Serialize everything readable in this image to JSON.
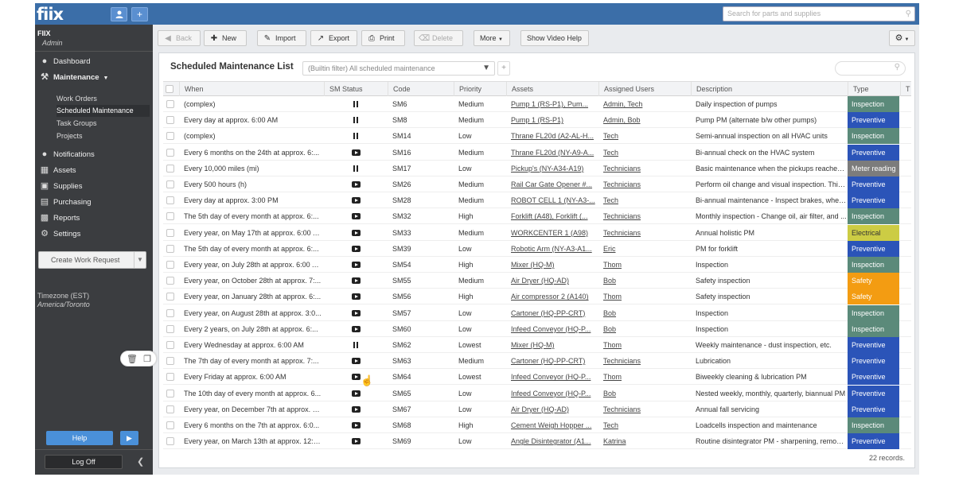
{
  "app": {
    "logo": "fiix",
    "org_name": "FIIX",
    "org_role": "Admin"
  },
  "topbar": {
    "user_icon": "user-icon",
    "add_icon": "plus-icon",
    "search_placeholder": "Search for parts and supplies"
  },
  "sidebar": {
    "nav": [
      {
        "label": "Dashboard",
        "icon": "dashboard-icon"
      },
      {
        "label": "Maintenance",
        "icon": "wrench-icon"
      },
      {
        "label": "Notifications",
        "icon": "chat-icon"
      },
      {
        "label": "Assets",
        "icon": "building-icon"
      },
      {
        "label": "Supplies",
        "icon": "box-icon"
      },
      {
        "label": "Purchasing",
        "icon": "cart-icon"
      },
      {
        "label": "Reports",
        "icon": "chart-icon"
      },
      {
        "label": "Settings",
        "icon": "gear-icon"
      }
    ],
    "sub_items": [
      "Work Orders",
      "Scheduled Maintenance",
      "Task Groups",
      "Projects"
    ],
    "create_work_request": "Create Work Request",
    "timezone_label": "Timezone (EST)",
    "timezone_value": "America/Toronto",
    "help": "Help",
    "logoff": "Log Off"
  },
  "toolbar": {
    "back": "Back",
    "new": "New",
    "import": "Import",
    "export": "Export",
    "print": "Print",
    "delete": "Delete",
    "more": "More",
    "show_video_help": "Show Video Help"
  },
  "panel": {
    "title": "Scheduled Maintenance List",
    "filter": "(Builtin filter) All scheduled maintenance",
    "add_filter": "+",
    "columns": [
      "When",
      "SM Status",
      "Code",
      "Priority",
      "Assets",
      "Assigned Users",
      "Description",
      "Type",
      "T"
    ],
    "rows": [
      {
        "when": "(complex)",
        "status": "paused",
        "code": "SM6",
        "priority": "Medium",
        "assets": "Pump 1 (RS-P1), Pum...",
        "users": "Admin, Tech",
        "description": "Daily inspection of pumps",
        "type": "Inspection"
      },
      {
        "when": "Every day at approx. 6:00 AM",
        "status": "paused",
        "code": "SM8",
        "priority": "Medium",
        "assets": "Pump 1 (RS-P1)",
        "users": "Admin, Bob",
        "description": "Pump PM (alternate b/w other pumps)",
        "type": "Preventive"
      },
      {
        "when": "(complex)",
        "status": "paused",
        "code": "SM14",
        "priority": "Low",
        "assets": "Thrane FL20d (A2-AL-H...",
        "users": "Tech",
        "description": "Semi-annual inspection on all HVAC units",
        "type": "Inspection"
      },
      {
        "when": "Every 6 months on the 24th at approx. 6:...",
        "status": "active",
        "code": "SM16",
        "priority": "Medium",
        "assets": "Thrane FL20d (NY-A9-A...",
        "users": "Tech",
        "description": "Bi-annual check on the HVAC system",
        "type": "Preventive"
      },
      {
        "when": "Every 10,000 miles (mi)",
        "status": "paused",
        "code": "SM17",
        "priority": "Low",
        "assets": "Pickup's (NY-A34-A19)",
        "users": "Technicians",
        "description": "Basic maintenance when the pickups reaches ...",
        "type": "Meter reading"
      },
      {
        "when": "Every 500 hours (h)",
        "status": "active",
        "code": "SM26",
        "priority": "Medium",
        "assets": "Rail Car Gate Opener #...",
        "users": "Technicians",
        "description": "Perform oil change and visual inspection. This ...",
        "type": "Preventive"
      },
      {
        "when": "Every day at approx. 3:00 PM",
        "status": "active",
        "code": "SM28",
        "priority": "Medium",
        "assets": "ROBOT CELL 1 (NY-A3-...",
        "users": "Tech",
        "description": "Bi-annual maintenance - Inspect brakes, whee...",
        "type": "Preventive"
      },
      {
        "when": "The 5th day of every month at approx. 6:...",
        "status": "active",
        "code": "SM32",
        "priority": "High",
        "assets": "Forklift (A48), Forklift (...",
        "users": "Technicians",
        "description": "Monthly inspection - Change oil, air filter, and ...",
        "type": "Inspection"
      },
      {
        "when": "Every year, on May 17th at approx. 6:00 AM",
        "status": "active",
        "code": "SM33",
        "priority": "Medium",
        "assets": "WORKCENTER 1 (A98)",
        "users": "Technicians",
        "description": "Annual holistic PM",
        "type": "Electrical"
      },
      {
        "when": "The 5th day of every month at approx. 6:...",
        "status": "active",
        "code": "SM39",
        "priority": "Low",
        "assets": "Robotic Arm (NY-A3-A1...",
        "users": "Eric",
        "description": "PM for forklift",
        "type": "Preventive"
      },
      {
        "when": "Every year, on July 28th at approx. 6:00 AM",
        "status": "active",
        "code": "SM54",
        "priority": "High",
        "assets": "Mixer (HQ-M)",
        "users": "Thom",
        "description": "Inspection",
        "type": "Inspection"
      },
      {
        "when": "Every year, on October 28th at approx. 7:...",
        "status": "active",
        "code": "SM55",
        "priority": "Medium",
        "assets": "Air Dryer (HQ-AD)",
        "users": "Bob",
        "description": "Safety inspection",
        "type": "Safety"
      },
      {
        "when": "Every year, on January 28th at approx. 6:...",
        "status": "active",
        "code": "SM56",
        "priority": "High",
        "assets": "Air compressor 2 (A140)",
        "users": "Thom",
        "description": "Safety inspection",
        "type": "Safety"
      },
      {
        "when": "Every year, on August 28th at approx. 3:0...",
        "status": "active",
        "code": "SM57",
        "priority": "Low",
        "assets": "Cartoner (HQ-PP-CRT)",
        "users": "Bob",
        "description": "Inspection",
        "type": "Inspection"
      },
      {
        "when": "Every 2 years, on July 28th at approx. 6:...",
        "status": "active",
        "code": "SM60",
        "priority": "Low",
        "assets": "Infeed Conveyor (HQ-P...",
        "users": "Bob",
        "description": "Inspection",
        "type": "Inspection"
      },
      {
        "when": "Every Wednesday at approx. 6:00 AM",
        "status": "paused",
        "code": "SM62",
        "priority": "Lowest",
        "assets": "Mixer (HQ-M)",
        "users": "Thom",
        "description": "Weekly maintenance - dust inspection, etc.",
        "type": "Preventive"
      },
      {
        "when": "The 7th day of every month at approx. 7:...",
        "status": "active",
        "code": "SM63",
        "priority": "Medium",
        "assets": "Cartoner (HQ-PP-CRT)",
        "users": "Technicians",
        "description": "Lubrication",
        "type": "Preventive"
      },
      {
        "when": "Every Friday at approx. 6:00 AM",
        "status": "active",
        "code": "SM64",
        "priority": "Lowest",
        "assets": "Infeed Conveyor (HQ-P...",
        "users": "Thom",
        "description": "Biweekly cleaning & lubrication PM",
        "type": "Preventive"
      },
      {
        "when": "The 10th day of every month at approx. 6...",
        "status": "active",
        "code": "SM65",
        "priority": "Low",
        "assets": "Infeed Conveyor (HQ-P...",
        "users": "Bob",
        "description": "Nested weekly, monthly, quarterly, biannual PM",
        "type": "Preventive"
      },
      {
        "when": "Every year, on December 7th at approx. 6...",
        "status": "active",
        "code": "SM67",
        "priority": "Low",
        "assets": "Air Dryer (HQ-AD)",
        "users": "Technicians",
        "description": "Annual fall servicing",
        "type": "Preventive"
      },
      {
        "when": "Every 6 months on the 7th at approx. 6:0...",
        "status": "active",
        "code": "SM68",
        "priority": "High",
        "assets": "Cement Weigh Hopper ...",
        "users": "Tech",
        "description": "Loadcells inspection and maintenance",
        "type": "Inspection"
      },
      {
        "when": "Every year, on March 13th at approx. 12:0...",
        "status": "active",
        "code": "SM69",
        "priority": "Low",
        "assets": "Angle Disintegrator (A1...",
        "users": "Katrina",
        "description": "Routine disintegrator PM - sharpening, removi...",
        "type": "Preventive"
      }
    ],
    "records": "22 records."
  },
  "colors": {
    "topbar": "#3b6ea8",
    "sidebar": "#3b3d40",
    "type": {
      "Inspection": "#5b8a7a",
      "Preventive": "#2b54b8",
      "Meter reading": "#7c7c7c",
      "Electrical": "#cccc44",
      "Safety": "#f39c12"
    }
  }
}
